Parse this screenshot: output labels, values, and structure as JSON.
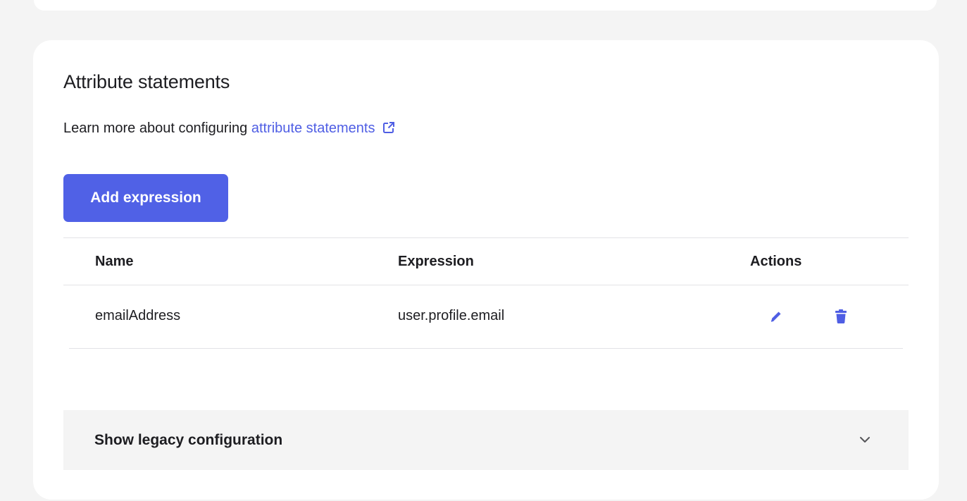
{
  "section": {
    "title": "Attribute statements",
    "learn_more_prefix": "Learn more about configuring ",
    "learn_more_link": "attribute statements",
    "add_button_label": "Add expression"
  },
  "table": {
    "headers": {
      "name": "Name",
      "expression": "Expression",
      "actions": "Actions"
    },
    "rows": [
      {
        "name": "emailAddress",
        "expression": "user.profile.email"
      }
    ]
  },
  "legacy": {
    "label": "Show legacy configuration"
  },
  "icons": {
    "external_link": "external-link-icon",
    "edit": "pencil-icon",
    "delete": "trash-icon",
    "expand": "chevron-down-icon"
  },
  "colors": {
    "accent": "#5061e6",
    "link": "#4f5ee4",
    "page_background": "#f4f4f4",
    "card_background": "#ffffff"
  }
}
